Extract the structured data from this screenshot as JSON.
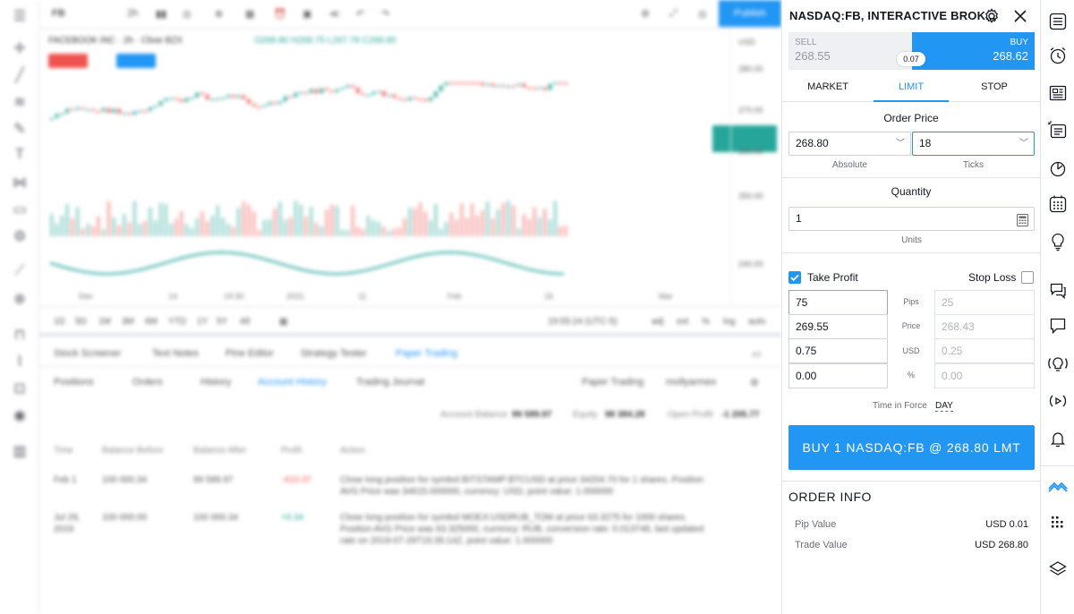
{
  "background": {
    "symbol": "FB",
    "timeframe": "2h",
    "chart_title": "FACEBOOK INC · 2h · Cboe BZX",
    "ohlc": "O268.80 H268.75 L267.78 C268.80",
    "publish_label": "Publish",
    "price_axis": [
      "USD",
      "280.00",
      "270.00",
      "260.00",
      "250.00",
      "240.00"
    ],
    "time_axis": [
      "Dec",
      "14",
      "19:30",
      "2021",
      "11",
      "Feb",
      "16",
      "Mar"
    ],
    "timeframes": [
      "1D",
      "5D",
      "1M",
      "3M",
      "6M",
      "YTD",
      "1Y",
      "5Y",
      "All"
    ],
    "clock": "19:55:24 (UTC-5)",
    "axis_toggles": [
      "adj",
      "ext",
      "%",
      "log",
      "auto"
    ],
    "bottom_tabs": [
      "Stock Screener",
      "Text Notes",
      "Pine Editor",
      "Strategy Tester",
      "Paper Trading"
    ],
    "sub_tabs": [
      "Positions",
      "Orders",
      "History",
      "Account History",
      "Trading Journal"
    ],
    "broker": "Paper Trading",
    "user": "mollyarmes",
    "account": [
      "Account Balance",
      "99 589.97",
      "Equity",
      "98 384.28",
      "Open Profit",
      "-1 205.77"
    ],
    "columns": [
      "Time",
      "Balance Before",
      "Balance After",
      "Profit",
      "Action"
    ],
    "rows": [
      {
        "time": "Feb 1",
        "before": "100 000.34",
        "after": "99 589.97",
        "profit": "-410.37",
        "action": "Close long position for symbol BITSTAMP:BTCUSD at price 34204.70 for 1 shares. Position AVG Price was 34615.000000, currency: USD, point value: 1.000000"
      },
      {
        "time": "Jul 29, 2019",
        "before": "100 000.00",
        "after": "100 000.34",
        "profit": "+0.34",
        "action": "Close long position for symbol MOEX:USDRUB_TOM at price 63.3275 for 1000 shares. Position AVG Price was 63.325000, currency: RUB, conversion rate: 0.013748, last updated rate on 2019-07-29T15:35:14Z, point value: 1.000000"
      }
    ]
  },
  "panel": {
    "title": "NASDAQ:FB, INTERACTIVE BROK...",
    "sell_label": "SELL",
    "sell_price": "268.55",
    "buy_label": "BUY",
    "buy_price": "268.62",
    "spread": "0.07",
    "order_tabs": [
      "MARKET",
      "LIMIT",
      "STOP"
    ],
    "active_tab": "LIMIT",
    "order_price_title": "Order Price",
    "price_value": "268.80",
    "price_caption": "Absolute",
    "ticks_value": "18",
    "ticks_caption": "Ticks",
    "quantity_title": "Quantity",
    "quantity_value": "1",
    "quantity_caption": "Units",
    "take_profit_label": "Take Profit",
    "stop_loss_label": "Stop Loss",
    "tp_fields": [
      "75",
      "269.55",
      "0.75",
      "0.00"
    ],
    "field_labels": [
      "Pips",
      "Price",
      "USD",
      "%"
    ],
    "sl_fields": [
      "25",
      "268.43",
      "0.25",
      "0.00"
    ],
    "tif_label": "Time in Force",
    "tif_value": "DAY",
    "submit_label": "BUY 1 NASDAQ:FB @ 268.80 LMT",
    "order_info_title": "ORDER INFO",
    "info": [
      {
        "label": "Pip Value",
        "value": "USD 0.01"
      },
      {
        "label": "Trade Value",
        "value": "USD 268.80"
      }
    ]
  },
  "colors": {
    "accent": "#2196f3",
    "up": "#26a69a",
    "down": "#ef5350"
  }
}
